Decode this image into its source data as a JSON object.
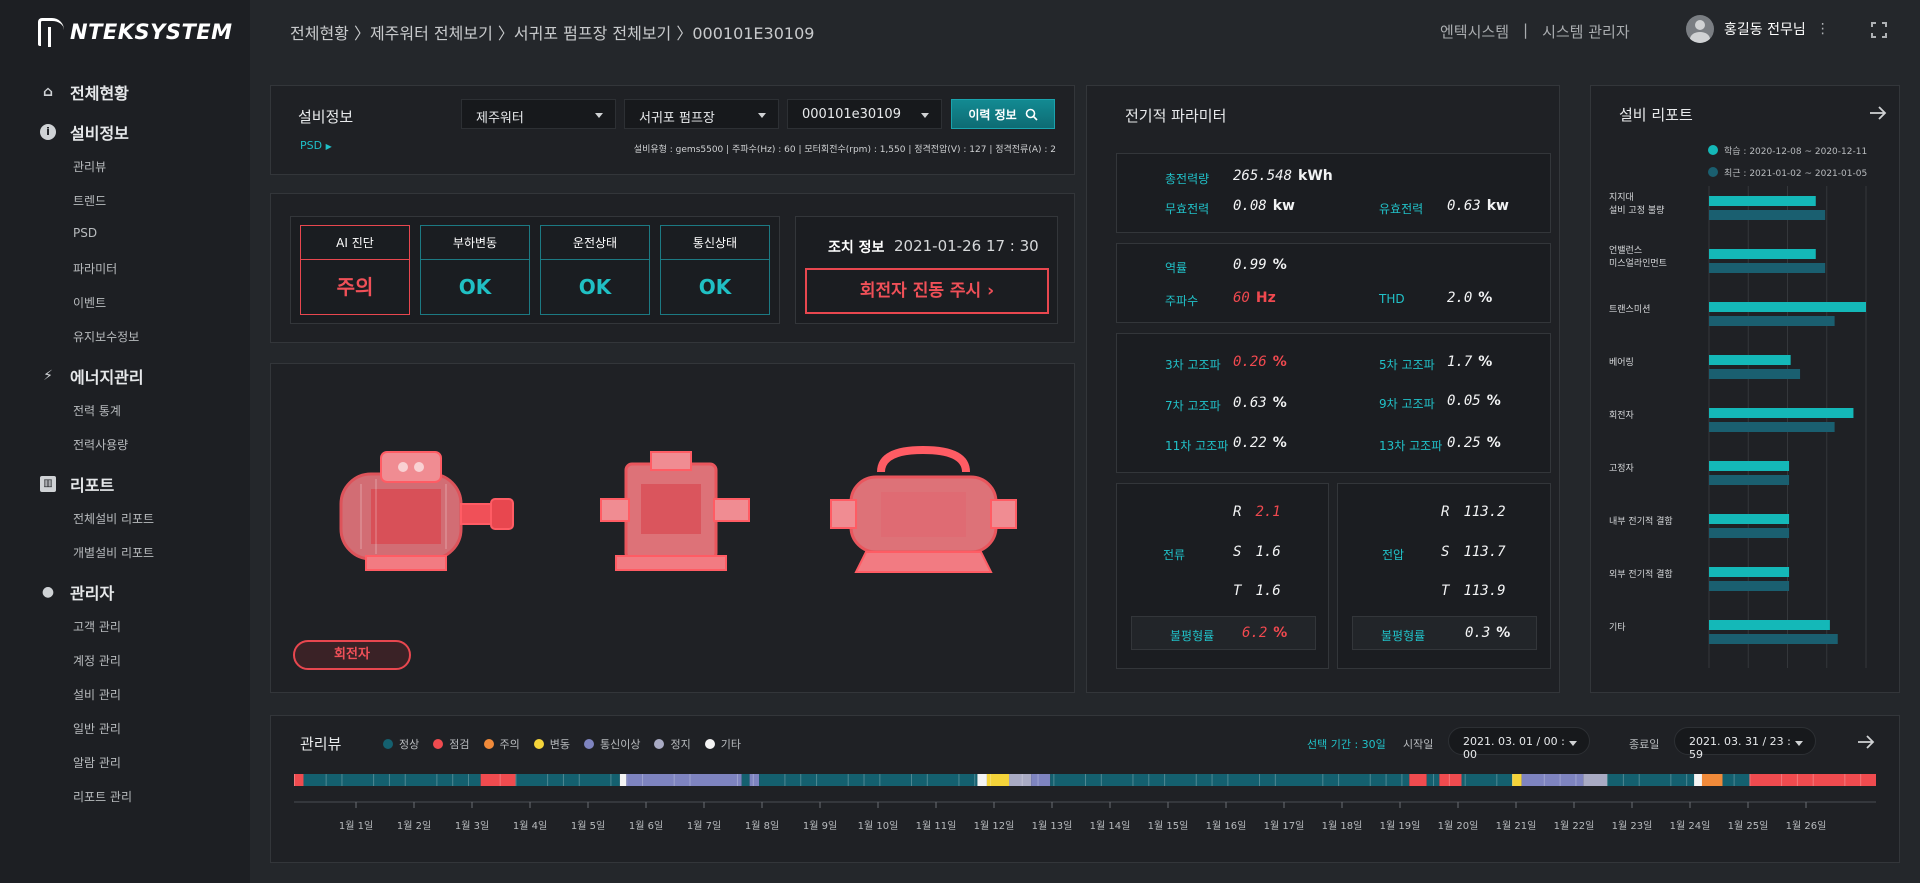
{
  "brand": "NTEKSYSTEM",
  "nav": {
    "sections": [
      {
        "label": "전체현황",
        "icon": "home-icon"
      },
      {
        "label": "설비정보",
        "icon": "info-icon"
      },
      {
        "label": "에너지관리",
        "icon": "bolt-icon"
      },
      {
        "label": "리포트",
        "icon": "report-icon"
      },
      {
        "label": "관리자",
        "icon": "person-icon"
      }
    ],
    "equipment_items": [
      "관리뷰",
      "트렌드",
      "PSD",
      "파라미터",
      "이벤트",
      "유지보수정보"
    ],
    "energy_items": [
      "전력 통계",
      "전력사용량"
    ],
    "report_items": [
      "전체설비 리포트",
      "개별설비 리포트"
    ],
    "admin_items": [
      "고객 관리",
      "계정 관리",
      "설비 관리",
      "일반 관리",
      "알람 관리",
      "리포트 관리"
    ]
  },
  "header": {
    "breadcrumb": "전체현황 〉제주워터 전체보기 〉서귀포 펌프장 전체보기 〉000101E30109",
    "company": "엔텍시스템",
    "separator": "|",
    "role": "시스템 관리자",
    "user_name": "홍길동 전무님",
    "more": "⋮"
  },
  "equipment": {
    "title": "설비정보",
    "select1": "제주워터",
    "select2": "서귀포 펌프장",
    "select3": "000101e30109",
    "history_button": "이력 정보",
    "psd_link": "PSD",
    "specs": "설비유형 : gems5500  |  주파수(Hz) : 60  |  모터회전수(rpm) : 1,550  |  정격전압(V) : 127  |  정격전류(A) : 2"
  },
  "status": {
    "cards": [
      {
        "label": "AI 진단",
        "value": "주의",
        "state": "warn"
      },
      {
        "label": "부하변동",
        "value": "OK",
        "state": "ok"
      },
      {
        "label": "운전상태",
        "value": "OK",
        "state": "ok"
      },
      {
        "label": "통신상태",
        "value": "OK",
        "state": "ok"
      }
    ],
    "action_label": "조치 정보",
    "action_time": "2021-01-26  17 : 30",
    "action_button": "회전자 진동 주시  ›"
  },
  "component_label": "회전자",
  "electrical": {
    "title": "전기적 파라미터",
    "total_power_label": "총전력량",
    "total_power_value": "265.548",
    "total_power_unit": "kWh",
    "reactive_label": "무효전력",
    "reactive_value": "0.08",
    "reactive_unit": "kw",
    "active_label": "유효전력",
    "active_value": "0.63",
    "active_unit": "kw",
    "pf_label": "역률",
    "pf_value": "0.99",
    "pf_unit": "%",
    "freq_label": "주파수",
    "freq_value": "60",
    "freq_unit": "Hz",
    "thd_label": "THD",
    "thd_value": "2.0",
    "thd_unit": "%",
    "h3_label": "3차 고조파",
    "h3_value": "0.26",
    "h3_unit": "%",
    "h5_label": "5차 고조파",
    "h5_value": "1.7",
    "h5_unit": "%",
    "h7_label": "7차 고조파",
    "h7_value": "0.63",
    "h7_unit": "%",
    "h9_label": "9차 고조파",
    "h9_value": "0.05",
    "h9_unit": "%",
    "h11_label": "11차 고조파",
    "h11_value": "0.22",
    "h11_unit": "%",
    "h13_label": "13차 고조파",
    "h13_value": "0.25",
    "h13_unit": "%",
    "current_label": "전류",
    "current": [
      {
        "phase": "R",
        "value": "2.1"
      },
      {
        "phase": "S",
        "value": "1.6"
      },
      {
        "phase": "T",
        "value": "1.6"
      }
    ],
    "current_unbalance_label": "불평형률",
    "current_unbalance_value": "6.2",
    "current_unbalance_unit": "%",
    "voltage_label": "전압",
    "voltage": [
      {
        "phase": "R",
        "value": "113.2"
      },
      {
        "phase": "S",
        "value": "113.7"
      },
      {
        "phase": "T",
        "value": "113.9"
      }
    ],
    "voltage_unbalance_label": "불평형률",
    "voltage_unbalance_value": "0.3",
    "voltage_unbalance_unit": "%"
  },
  "report": {
    "title": "설비 리포트",
    "legend_learn": "학습 : 2020-12-08 ~ 2020-12-11",
    "legend_recent": "최근 : 2021-01-02 ~ 2021-01-05",
    "colors": {
      "learn": "#14b8b8",
      "recent": "#1a5f70"
    },
    "rows": [
      {
        "label": "지지대\n설비 고정 불량",
        "learn": 0.68,
        "recent": 0.74
      },
      {
        "label": "언밸런스\n미스얼라인먼트",
        "learn": 0.68,
        "recent": 0.74
      },
      {
        "label": "트랜스미션",
        "learn": 1.0,
        "recent": 0.8
      },
      {
        "label": "베어링",
        "learn": 0.52,
        "recent": 0.58
      },
      {
        "label": "회전자",
        "learn": 0.92,
        "recent": 0.8
      },
      {
        "label": "고정자",
        "learn": 0.51,
        "recent": 0.51
      },
      {
        "label": "내부 전기적 결함",
        "learn": 0.51,
        "recent": 0.51
      },
      {
        "label": "외부 전기적 결함",
        "learn": 0.51,
        "recent": 0.51
      },
      {
        "label": "기타",
        "learn": 0.77,
        "recent": 0.82
      }
    ]
  },
  "timeline": {
    "title": "관리뷰",
    "legend": [
      {
        "label": "정상",
        "color": "#14606f"
      },
      {
        "label": "점검",
        "color": "#ef4b4f"
      },
      {
        "label": "주의",
        "color": "#f08a3a"
      },
      {
        "label": "변동",
        "color": "#f4d43a"
      },
      {
        "label": "통신이상",
        "color": "#7e84c0"
      },
      {
        "label": "정지",
        "color": "#a9abc4"
      },
      {
        "label": "기타",
        "color": "#f4f4f4"
      }
    ],
    "period_label": "선택 기간 : 30일",
    "start_label": "시작일",
    "start_value": "2021. 03. 01 / 00 : 00",
    "end_label": "종료일",
    "end_value": "2021. 03. 31 / 23 : 59",
    "days": [
      "1월 1일",
      "1월 2일",
      "1월 3일",
      "1월 4일",
      "1월 5일",
      "1월 6일",
      "1월 7일",
      "1월 8일",
      "1월 9일",
      "1월 10일",
      "1월 11일",
      "1월 12일",
      "1월 13일",
      "1월 14일",
      "1월 15일",
      "1월 16일",
      "1월 17일",
      "1월 18일",
      "1월 19일",
      "1월 20일",
      "1월 21일",
      "1월 22일",
      "1월 23일",
      "1월 24일",
      "1월 25일",
      "1월 26일"
    ],
    "segments": [
      {
        "s": 0.0,
        "e": 0.006,
        "c": "#ef4b4f"
      },
      {
        "s": 0.006,
        "e": 0.118,
        "c": "#14606f"
      },
      {
        "s": 0.118,
        "e": 0.14,
        "c": "#ef4b4f"
      },
      {
        "s": 0.14,
        "e": 0.206,
        "c": "#14606f"
      },
      {
        "s": 0.206,
        "e": 0.21,
        "c": "#f4f4f4"
      },
      {
        "s": 0.21,
        "e": 0.283,
        "c": "#7e84c0"
      },
      {
        "s": 0.283,
        "e": 0.288,
        "c": "#14606f"
      },
      {
        "s": 0.288,
        "e": 0.294,
        "c": "#7e84c0"
      },
      {
        "s": 0.294,
        "e": 0.432,
        "c": "#14606f"
      },
      {
        "s": 0.432,
        "e": 0.438,
        "c": "#f4f4f4"
      },
      {
        "s": 0.438,
        "e": 0.452,
        "c": "#f4d43a"
      },
      {
        "s": 0.452,
        "e": 0.466,
        "c": "#a9abc4"
      },
      {
        "s": 0.466,
        "e": 0.478,
        "c": "#7e84c0"
      },
      {
        "s": 0.478,
        "e": 0.705,
        "c": "#14606f"
      },
      {
        "s": 0.705,
        "e": 0.716,
        "c": "#ef4b4f"
      },
      {
        "s": 0.716,
        "e": 0.724,
        "c": "#14606f"
      },
      {
        "s": 0.724,
        "e": 0.738,
        "c": "#ef4b4f"
      },
      {
        "s": 0.738,
        "e": 0.77,
        "c": "#14606f"
      },
      {
        "s": 0.77,
        "e": 0.776,
        "c": "#f4d43a"
      },
      {
        "s": 0.776,
        "e": 0.815,
        "c": "#7e84c0"
      },
      {
        "s": 0.815,
        "e": 0.83,
        "c": "#a9abc4"
      },
      {
        "s": 0.83,
        "e": 0.885,
        "c": "#14606f"
      },
      {
        "s": 0.885,
        "e": 0.89,
        "c": "#f4f4f4"
      },
      {
        "s": 0.89,
        "e": 0.903,
        "c": "#f08a3a"
      },
      {
        "s": 0.903,
        "e": 0.92,
        "c": "#14606f"
      },
      {
        "s": 0.92,
        "e": 1.0,
        "c": "#ef4b4f"
      }
    ]
  }
}
